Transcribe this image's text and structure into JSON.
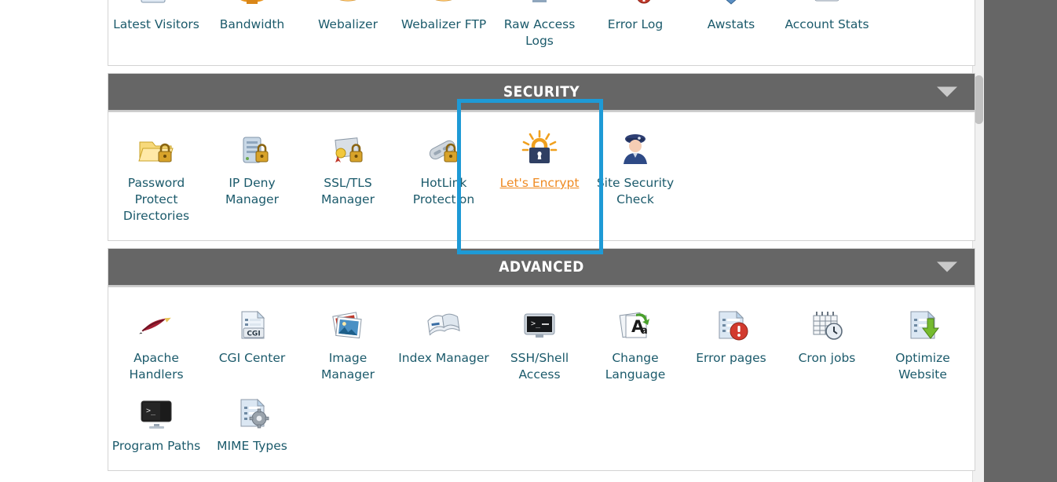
{
  "page": {
    "app": "cPanel",
    "background_color": "#666666",
    "panel_background": "#ffffff",
    "label_color": "#1b5a6b",
    "header_color": "#666666",
    "highlight_color": "#1e9ad6",
    "hover_link_color": "#ef8b23"
  },
  "scrollbar": {
    "name": "vertical-scrollbar",
    "thumb_top_pct": 16
  },
  "groups": [
    {
      "id": "metrics",
      "header_visible": false,
      "header_label": "",
      "items": [
        {
          "label": "Latest Visitors",
          "icon": "latest-visitors-icon"
        },
        {
          "label": "Bandwidth",
          "icon": "bandwidth-icon"
        },
        {
          "label": "Webalizer",
          "icon": "webalizer-icon"
        },
        {
          "label": "Webalizer FTP",
          "icon": "webalizer-ftp-icon"
        },
        {
          "label": "Raw Access Logs",
          "icon": "raw-access-logs-icon"
        },
        {
          "label": "Error Log",
          "icon": "error-log-icon"
        },
        {
          "label": "Awstats",
          "icon": "awstats-icon"
        },
        {
          "label": "Account Stats",
          "icon": "account-stats-icon"
        }
      ]
    },
    {
      "id": "security",
      "header_visible": true,
      "header_label": "SECURITY",
      "chevron": "chevron-down-icon",
      "items": [
        {
          "label": "Password Protect Directories",
          "icon": "password-protect-directories-icon",
          "hovered": false
        },
        {
          "label": "IP Deny Manager",
          "icon": "ip-deny-manager-icon",
          "hovered": false
        },
        {
          "label": "SSL/TLS Manager",
          "icon": "ssl-tls-manager-icon",
          "hovered": false
        },
        {
          "label": "HotLink Protection",
          "icon": "hotlink-protection-icon",
          "hovered": false
        },
        {
          "label": "Let's Encrypt",
          "icon": "lets-encrypt-icon",
          "hovered": true
        },
        {
          "label": "Site Security Check",
          "icon": "site-security-check-icon",
          "hovered": false
        }
      ]
    },
    {
      "id": "advanced",
      "header_visible": true,
      "header_label": "ADVANCED",
      "chevron": "chevron-down-icon",
      "items": [
        {
          "label": "Apache Handlers",
          "icon": "apache-handlers-icon"
        },
        {
          "label": "CGI Center",
          "icon": "cgi-center-icon"
        },
        {
          "label": "Image Manager",
          "icon": "image-manager-icon"
        },
        {
          "label": "Index Manager",
          "icon": "index-manager-icon"
        },
        {
          "label": "SSH/Shell Access",
          "icon": "ssh-shell-access-icon"
        },
        {
          "label": "Change Language",
          "icon": "change-language-icon"
        },
        {
          "label": "Error pages",
          "icon": "error-pages-icon"
        },
        {
          "label": "Cron jobs",
          "icon": "cron-jobs-icon"
        },
        {
          "label": "Optimize Website",
          "icon": "optimize-website-icon"
        },
        {
          "label": "Program Paths",
          "icon": "program-paths-icon"
        },
        {
          "label": "MIME Types",
          "icon": "mime-types-icon"
        }
      ]
    }
  ],
  "annotation": {
    "name": "lets-encrypt-highlight-box",
    "target": "Let's Encrypt",
    "color": "#1e9ad6"
  }
}
